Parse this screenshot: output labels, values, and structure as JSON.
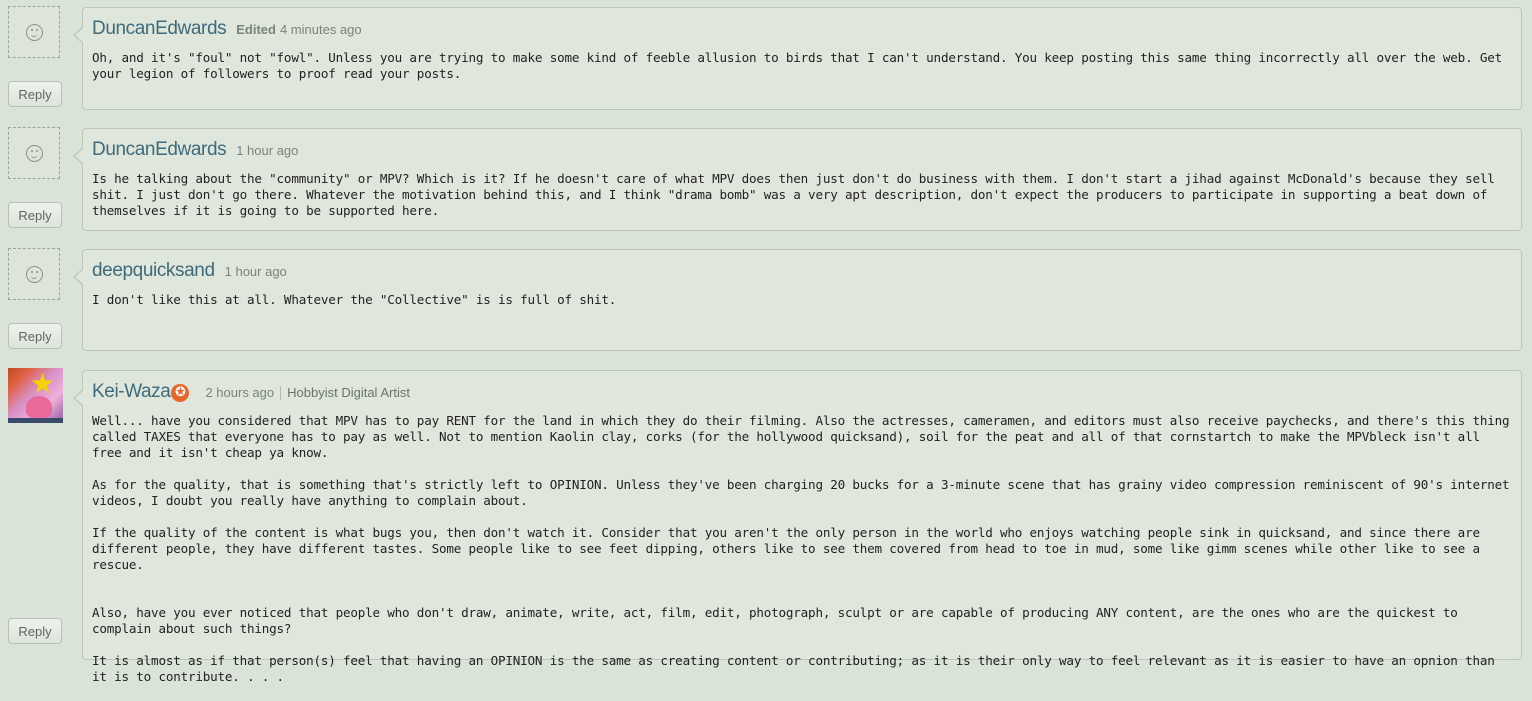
{
  "reply_label": "Reply",
  "comments": [
    {
      "username": "DuncanEdwards",
      "edited": "Edited",
      "time": "4 minutes ago",
      "paragraphs": [
        "Oh, and it's \"foul\" not \"fowl\". Unless you are trying to make some kind of feeble allusion to birds that I can't understand. You keep posting this same thing incorrectly all over the web. Get your legion of followers to proof read your posts."
      ]
    },
    {
      "username": "DuncanEdwards",
      "time": "1 hour ago",
      "paragraphs": [
        "Is he talking about the \"community\" or MPV? Which is it? If he doesn't care of what MPV does then just don't do business with them. I don't start a jihad against McDonald's because they sell shit. I just don't go there. Whatever the motivation behind this, and I think \"drama bomb\" was a very apt description, don't expect the producers to participate in supporting a beat down of themselves if it is going to be supported here."
      ]
    },
    {
      "username": "deepquicksand",
      "time": "1 hour ago",
      "paragraphs": [
        "I don't like this at all. Whatever the \"Collective\" is is full of shit."
      ]
    },
    {
      "username": "Kei-Waza",
      "badge": "✪",
      "time": "2 hours ago",
      "title": "Hobbyist Digital Artist",
      "paragraphs": [
        "Well... have you considered that MPV has to pay RENT for the land in which they do their filming. Also the actresses, cameramen, and editors must also receive paychecks, and there's this thing called TAXES that everyone has to pay as well. Not to mention Kaolin clay, corks (for the hollywood quicksand), soil for the peat and all of that cornstartch to make the MPVbleck isn't all free and it isn't cheap ya know.",
        "As for the quality, that is something that's strictly left to OPINION.  Unless they've been charging 20 bucks for a 3-minute scene that has grainy video compression reminiscent of 90's internet videos, I doubt you really have anything to complain about.",
        "If the quality of the content is what bugs you, then don't watch it. Consider that you aren't the only person in the world who enjoys watching people sink in quicksand, and since there are different people, they have different tastes. Some people like to see feet dipping, others like to see them covered from head to toe in mud, some like gimm scenes while other like to see a rescue.",
        "Also, have you ever noticed that people who don't draw, animate, write, act, film, edit, photograph, sculpt or are capable of producing ANY content, are the ones who are the quickest to complain about such things?",
        "It is almost as if that person(s) feel that having an OPINION is the same as creating content or contributing; as it is their only way to feel relevant as it is easier to have an opnion than it is to contribute. .  .  ."
      ]
    }
  ]
}
